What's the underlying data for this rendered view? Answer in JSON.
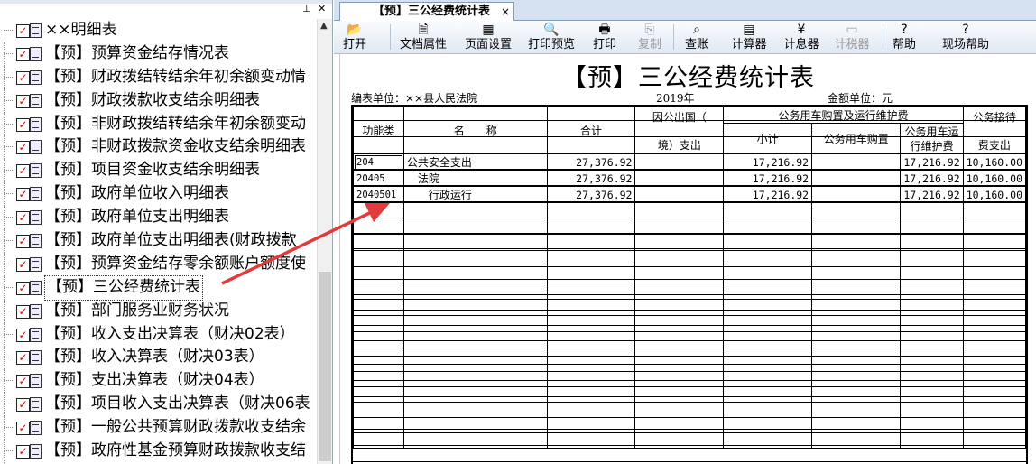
{
  "tree": {
    "pin_icon": "pin-icon",
    "root_label": "××明细表",
    "items": [
      {
        "label": "【预】预算资金结存情况表",
        "selected": false
      },
      {
        "label": "【预】财政拨结转结余年初余额变动情",
        "selected": false
      },
      {
        "label": "【预】财政拨款收支结余明细表",
        "selected": false
      },
      {
        "label": "【预】非财政拨结转结余年初余额变动",
        "selected": false
      },
      {
        "label": "【预】非财政拨款资金收支结余明细表",
        "selected": false
      },
      {
        "label": "【预】项目资金收支结余明细表",
        "selected": false
      },
      {
        "label": "【预】政府单位收入明细表",
        "selected": false
      },
      {
        "label": "【预】政府单位支出明细表",
        "selected": false
      },
      {
        "label": "【预】政府单位支出明细表(财政拨款",
        "selected": false
      },
      {
        "label": "【预】预算资金结存零余额账户额度使",
        "selected": false
      },
      {
        "label": "【预】三公经费统计表",
        "selected": true
      },
      {
        "label": "【预】部门服务业财务状况",
        "selected": false
      },
      {
        "label": "【预】收入支出决算表（财决02表）",
        "selected": false
      },
      {
        "label": "【预】收入决算表（财决03表）",
        "selected": false
      },
      {
        "label": "【预】支出决算表（财决04表）",
        "selected": false
      },
      {
        "label": "【预】项目收入支出决算表（财决06表",
        "selected": false
      },
      {
        "label": "【预】一般公共预算财政拨款收支结余",
        "selected": false
      },
      {
        "label": "【预】政府性基金预算财政拨款收支结",
        "selected": false
      }
    ]
  },
  "tab": {
    "title": "【预】三公经费统计表",
    "close": "×"
  },
  "toolbar": {
    "buttons": [
      {
        "label": "打开",
        "icon": "open-folder-icon",
        "glyph": "📂",
        "enabled": true
      },
      {
        "label": "文档属性",
        "icon": "doc-properties-icon",
        "glyph": "🗎",
        "enabled": true
      },
      {
        "label": "页面设置",
        "icon": "page-setup-icon",
        "glyph": "▦",
        "enabled": true
      },
      {
        "label": "打印预览",
        "icon": "print-preview-icon",
        "glyph": "🔍",
        "enabled": true
      },
      {
        "label": "打印",
        "icon": "print-icon",
        "glyph": "🖶",
        "enabled": true
      },
      {
        "label": "复制",
        "icon": "copy-icon",
        "glyph": "⎘",
        "enabled": false
      },
      {
        "label": "查账",
        "icon": "search-icon",
        "glyph": "⌕",
        "enabled": true
      },
      {
        "label": "计算器",
        "icon": "calculator-icon",
        "glyph": "▤",
        "enabled": true
      },
      {
        "label": "计息器",
        "icon": "yen-icon",
        "glyph": "¥",
        "enabled": true
      },
      {
        "label": "计税器",
        "icon": "tax-icon",
        "glyph": "▭",
        "enabled": false
      },
      {
        "label": "帮助",
        "icon": "help-icon",
        "glyph": "?",
        "enabled": true
      },
      {
        "label": "现场帮助",
        "icon": "context-help-icon",
        "glyph": "?",
        "enabled": true
      }
    ]
  },
  "report": {
    "title": "【预】三公经费统计表",
    "unit_label": "编表单位：××县人民法院",
    "year": "2019年",
    "amount_unit": "金额单位：元",
    "headers": {
      "func": "功能类",
      "name": "名　　称",
      "total": "合计",
      "abroad_1": "因公出国（",
      "abroad_2": "境）支出",
      "car_group": "公务用车购置及运行维护费",
      "subtotal": "小计",
      "car_purchase": "公务用车购置",
      "car_run_1": "公务用车运",
      "car_run_2": "行维护费",
      "hosp_1": "公务接待",
      "hosp_2": "费支出"
    },
    "rows": [
      {
        "code": "204",
        "name": "公共安全支出",
        "indent": 0,
        "total": "27,376.92",
        "abroad": "",
        "subtotal": "17,216.92",
        "purchase": "",
        "running": "17,216.92",
        "reception": "10,160.00"
      },
      {
        "code": "20405",
        "name": "法院",
        "indent": 1,
        "total": "27,376.92",
        "abroad": "",
        "subtotal": "17,216.92",
        "purchase": "",
        "running": "17,216.92",
        "reception": "10,160.00"
      },
      {
        "code": "2040501",
        "name": "行政运行",
        "indent": 2,
        "total": "27,376.92",
        "abroad": "",
        "subtotal": "17,216.92",
        "purchase": "",
        "running": "17,216.92",
        "reception": "10,160.00"
      }
    ]
  }
}
